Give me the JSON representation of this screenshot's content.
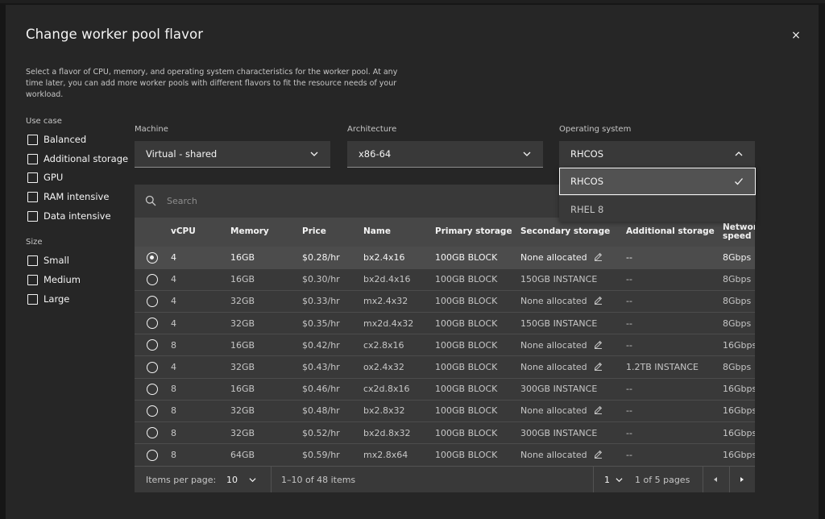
{
  "modal": {
    "title": "Change worker pool flavor",
    "close_glyph": "×",
    "description": "Select a flavor of CPU, memory, and operating system characteristics for the worker pool. At any time later, you can add more worker pools with different flavors to fit the resource needs of your workload."
  },
  "filters": {
    "use_case": {
      "title": "Use case",
      "options": [
        "Balanced",
        "Additional storage",
        "GPU",
        "RAM intensive",
        "Data intensive"
      ]
    },
    "size": {
      "title": "Size",
      "options": [
        "Small",
        "Medium",
        "Large"
      ]
    }
  },
  "dropdowns": {
    "machine": {
      "label": "Machine",
      "value": "Virtual - shared"
    },
    "architecture": {
      "label": "Architecture",
      "value": "x86-64"
    },
    "os": {
      "label": "Operating system",
      "value": "RHCOS",
      "options": [
        "RHCOS",
        "RHEL 8"
      ]
    }
  },
  "search": {
    "placeholder": "Search"
  },
  "table": {
    "headers": [
      "vCPU",
      "Memory",
      "Price",
      "Name",
      "Primary storage",
      "Secondary storage",
      "Additional storage",
      "Network speed"
    ],
    "selected_row": 0,
    "rows": [
      {
        "vcpu": "4",
        "memory": "16GB",
        "price": "$0.28/hr",
        "name": "bx2.4x16",
        "primary": "100GB BLOCK",
        "secondary": "None allocated",
        "editable": true,
        "additional": "--",
        "network": "8Gbps"
      },
      {
        "vcpu": "4",
        "memory": "16GB",
        "price": "$0.30/hr",
        "name": "bx2d.4x16",
        "primary": "100GB BLOCK",
        "secondary": "150GB INSTANCE",
        "editable": false,
        "additional": "--",
        "network": "8Gbps"
      },
      {
        "vcpu": "4",
        "memory": "32GB",
        "price": "$0.33/hr",
        "name": "mx2.4x32",
        "primary": "100GB BLOCK",
        "secondary": "None allocated",
        "editable": true,
        "additional": "--",
        "network": "8Gbps"
      },
      {
        "vcpu": "4",
        "memory": "32GB",
        "price": "$0.35/hr",
        "name": "mx2d.4x32",
        "primary": "100GB BLOCK",
        "secondary": "150GB INSTANCE",
        "editable": false,
        "additional": "--",
        "network": "8Gbps"
      },
      {
        "vcpu": "8",
        "memory": "16GB",
        "price": "$0.42/hr",
        "name": "cx2.8x16",
        "primary": "100GB BLOCK",
        "secondary": "None allocated",
        "editable": true,
        "additional": "--",
        "network": "16Gbps"
      },
      {
        "vcpu": "4",
        "memory": "32GB",
        "price": "$0.43/hr",
        "name": "ox2.4x32",
        "primary": "100GB BLOCK",
        "secondary": "None allocated",
        "editable": true,
        "additional": "1.2TB INSTANCE",
        "network": "8Gbps"
      },
      {
        "vcpu": "8",
        "memory": "16GB",
        "price": "$0.46/hr",
        "name": "cx2d.8x16",
        "primary": "100GB BLOCK",
        "secondary": "300GB INSTANCE",
        "editable": false,
        "additional": "--",
        "network": "16Gbps"
      },
      {
        "vcpu": "8",
        "memory": "32GB",
        "price": "$0.48/hr",
        "name": "bx2.8x32",
        "primary": "100GB BLOCK",
        "secondary": "None allocated",
        "editable": true,
        "additional": "--",
        "network": "16Gbps"
      },
      {
        "vcpu": "8",
        "memory": "32GB",
        "price": "$0.52/hr",
        "name": "bx2d.8x32",
        "primary": "100GB BLOCK",
        "secondary": "300GB INSTANCE",
        "editable": false,
        "additional": "--",
        "network": "16Gbps"
      },
      {
        "vcpu": "8",
        "memory": "64GB",
        "price": "$0.59/hr",
        "name": "mx2.8x64",
        "primary": "100GB BLOCK",
        "secondary": "None allocated",
        "editable": true,
        "additional": "--",
        "network": "16Gbps"
      }
    ]
  },
  "pagination": {
    "items_per_page_label": "Items per page:",
    "items_per_page": "10",
    "range_text": "1–10 of 48 items",
    "page": "1",
    "page_of_text": "1 of 5 pages"
  },
  "colors": {
    "modal_bg": "#262626",
    "field_bg": "#393939",
    "header_bg": "#474747",
    "selected_row_bg": "#4c4c4c",
    "text_primary": "#f4f4f4",
    "text_secondary": "#c6c6c6"
  },
  "icons": {
    "close": "close-icon",
    "dropdown": "chevron-down-icon",
    "dropdown_open": "chevron-up-icon",
    "selected": "checkmark-icon",
    "search": "search-icon",
    "edit": "pencil-icon",
    "prev": "caret-left-icon",
    "next": "caret-right-icon"
  }
}
